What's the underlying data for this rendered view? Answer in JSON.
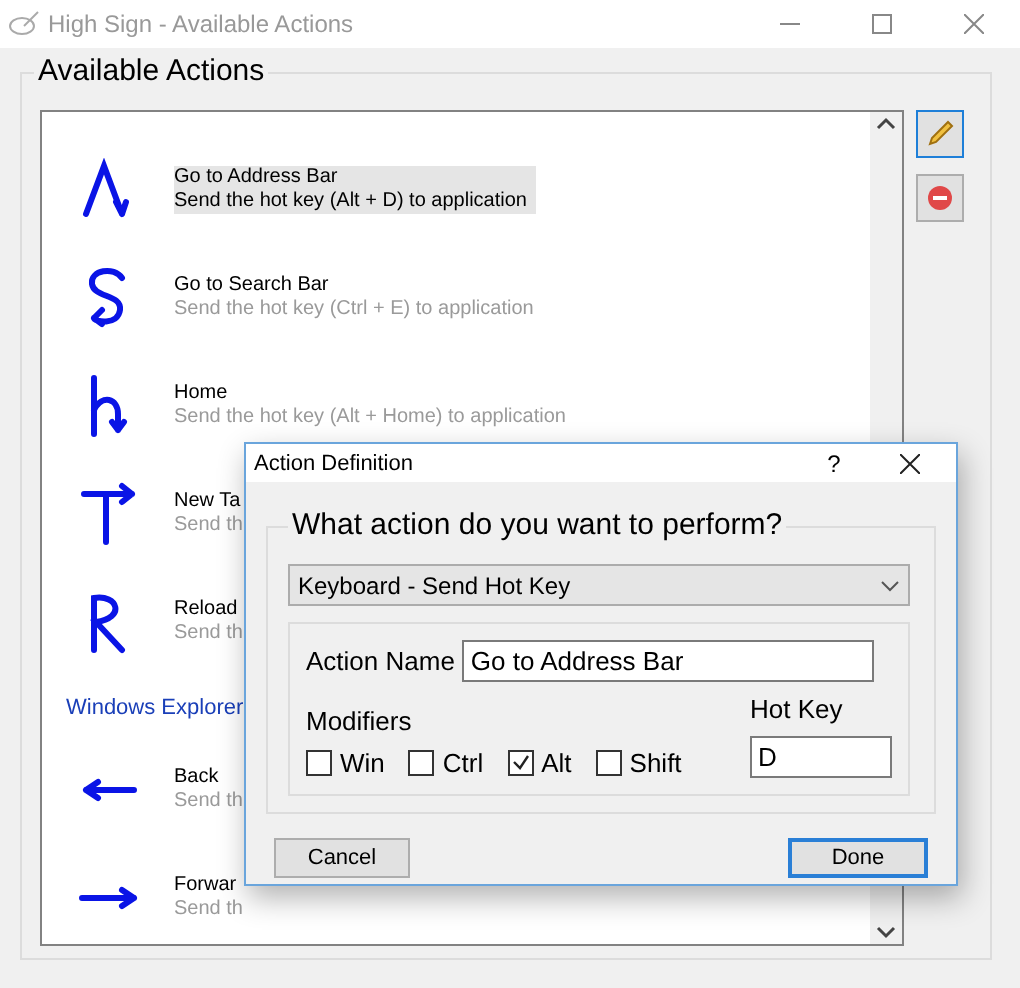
{
  "window": {
    "title": "High Sign - Available Actions"
  },
  "group_title": "Available Actions",
  "actions": [
    {
      "kind": "action",
      "gesture": {
        "kind": "caret"
      },
      "name": "Go to Address Bar",
      "description": "Send the hot key (Alt + D) to application",
      "selected": true
    },
    {
      "kind": "action",
      "gesture": {
        "kind": "s"
      },
      "name": "Go to Search Bar",
      "description": "Send the hot key (Ctrl + E) to application",
      "selected": false
    },
    {
      "kind": "action",
      "gesture": {
        "kind": "h"
      },
      "name": "Home",
      "description": "Send the hot key (Alt + Home) to application",
      "selected": false
    },
    {
      "kind": "action",
      "gesture": {
        "kind": "t"
      },
      "name": "New Ta",
      "description": "Send th",
      "selected": false
    },
    {
      "kind": "action",
      "gesture": {
        "kind": "r"
      },
      "name": "Reload",
      "description": "Send th",
      "selected": false
    },
    {
      "kind": "header",
      "name": "Windows Explorer"
    },
    {
      "kind": "action",
      "gesture": {
        "kind": "left"
      },
      "name": "Back",
      "description": "Send th",
      "selected": false
    },
    {
      "kind": "action",
      "gesture": {
        "kind": "right"
      },
      "name": "Forwar",
      "description": "Send th",
      "selected": false
    }
  ],
  "dialog": {
    "title": "Action Definition",
    "help": "?",
    "question": "What action do you want to perform?",
    "action_type": "Keyboard - Send Hot Key",
    "action_name_label": "Action Name",
    "action_name": "Go to Address Bar",
    "modifiers_label": "Modifiers",
    "hot_key_label": "Hot Key",
    "hot_key": "D",
    "modifiers": [
      {
        "label": "Win",
        "checked": false
      },
      {
        "label": "Ctrl",
        "checked": false
      },
      {
        "label": "Alt",
        "checked": true
      },
      {
        "label": "Shift",
        "checked": false
      }
    ],
    "buttons": [
      {
        "label": "Cancel",
        "default": false
      },
      {
        "label": "Done",
        "default": true
      }
    ]
  }
}
